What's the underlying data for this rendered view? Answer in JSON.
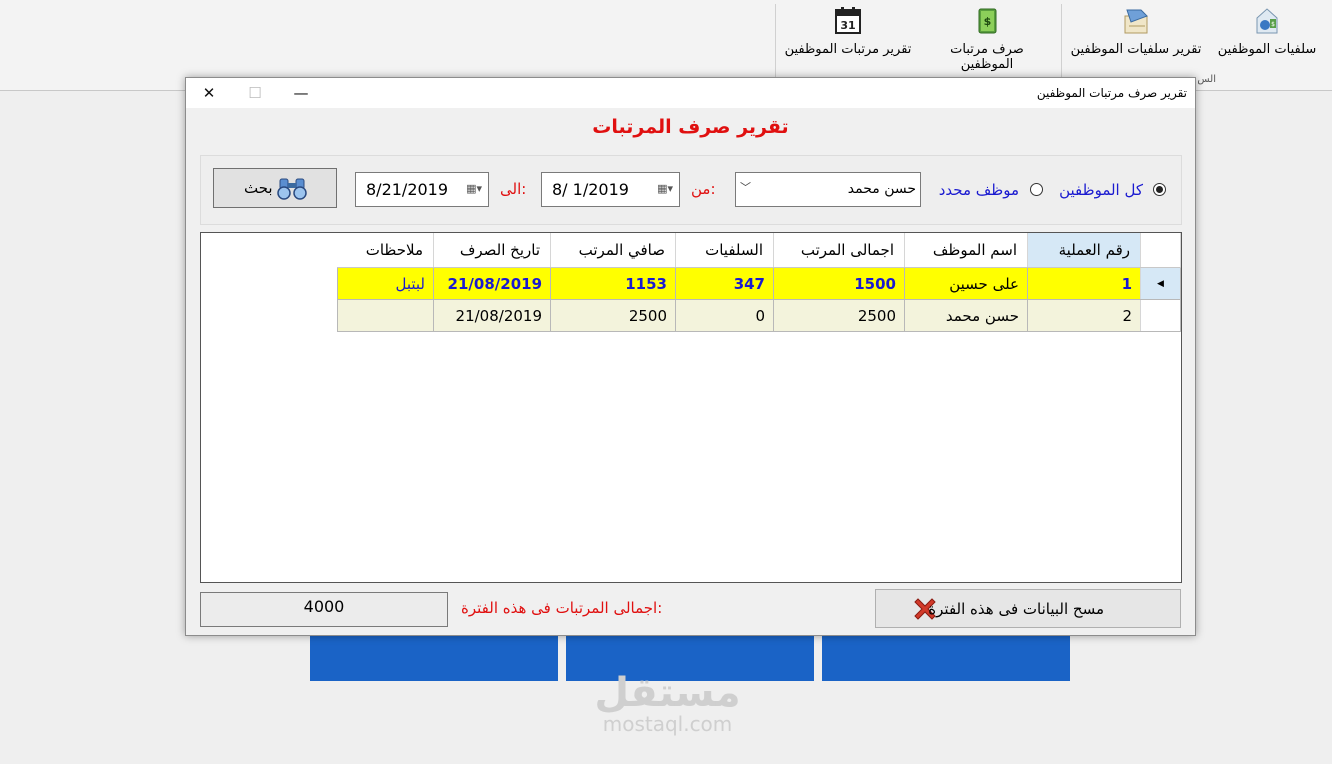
{
  "ribbon": {
    "buttons": [
      {
        "label": "سلفيات الموظفين",
        "icon": "employee-advances-icon"
      },
      {
        "label": "تقرير سلفيات الموظفين",
        "icon": "advances-report-icon"
      },
      {
        "label": "صرف مرتبات الموظفين",
        "icon": "salary-pay-icon"
      },
      {
        "label": "تقرير مرتبات الموظفين",
        "icon": "calendar-icon"
      }
    ],
    "calendar_day": "31",
    "group_label": "الس"
  },
  "window": {
    "title": "تقرير صرف مرتبات الموظفين",
    "heading": "تقرير صرف المرتبات"
  },
  "filter": {
    "all_employees_label": "كل الموظفين",
    "specific_employee_label": "موظف محدد",
    "all_selected": true,
    "employee_value": "حسن محمد",
    "from_label": "من:",
    "from_date": "8/  1/2019",
    "to_label": "الى:",
    "to_date": "8/21/2019",
    "search_label": "بحث"
  },
  "grid": {
    "columns": [
      "رقم العملية",
      "اسم الموظف",
      "اجمالى المرتب",
      "السلفيات",
      "صافي المرتب",
      "تاريخ الصرف",
      "ملاحظات"
    ],
    "rows": [
      {
        "id": "1",
        "name": "على حسين",
        "total": "1500",
        "advances": "347",
        "net": "1153",
        "date": "21/08/2019",
        "note": "لبتبل"
      },
      {
        "id": "2",
        "name": "حسن محمد",
        "total": "2500",
        "advances": "0",
        "net": "2500",
        "date": "21/08/2019",
        "note": ""
      }
    ]
  },
  "footer": {
    "total_label": "اجمالى المرتبات فى هذه الفترة:",
    "total_value": "4000",
    "clear_label": "مسح البيانات فى هذه الفترة"
  },
  "watermark": {
    "arabic": "مستقل",
    "latin": "mostaql.com"
  },
  "colors": {
    "accent_red": "#e01010",
    "link_blue": "#1a1ad0",
    "selected_row": "#ffff00",
    "tile_blue": "#1a63c6"
  }
}
